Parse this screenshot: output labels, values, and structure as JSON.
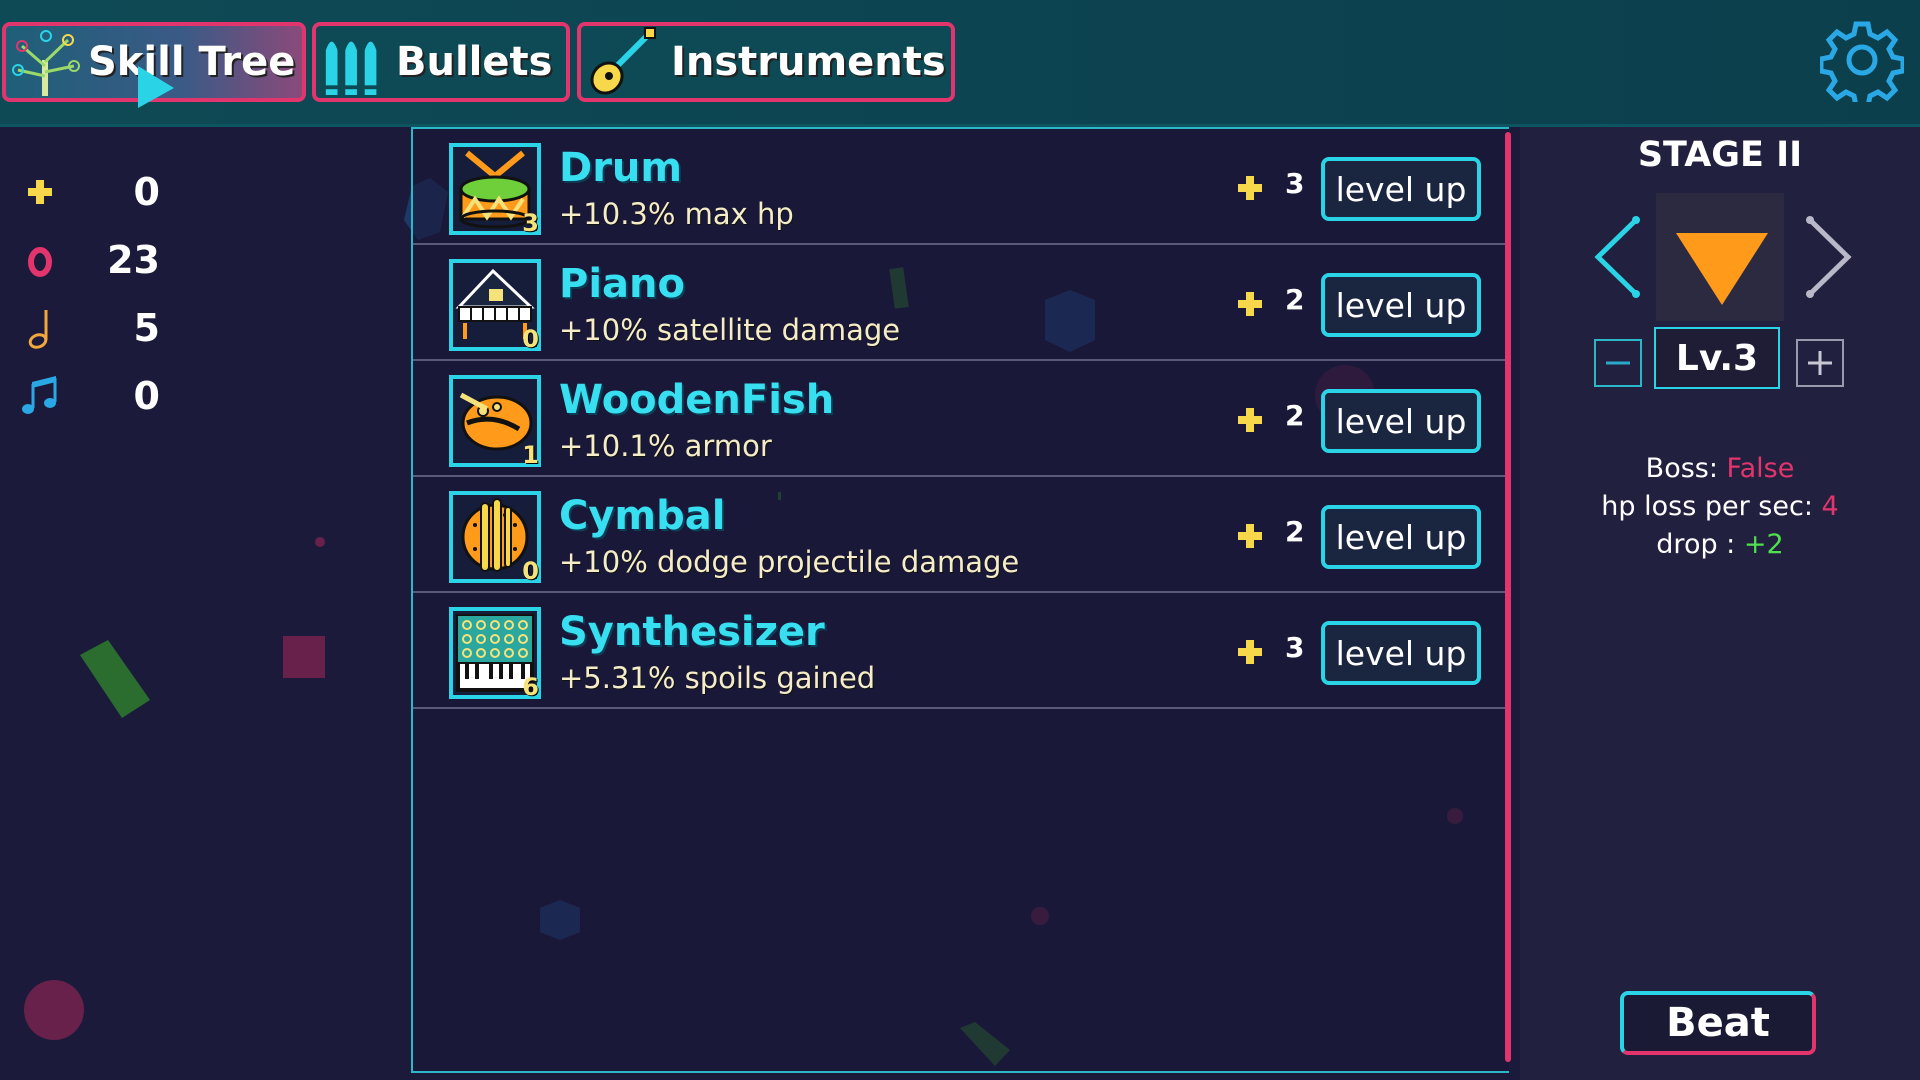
{
  "tabs": [
    {
      "label": "Skill Tree",
      "icon": "tree-icon",
      "active": true
    },
    {
      "label": "Bullets",
      "icon": "bullets-icon",
      "active": false
    },
    {
      "label": "Instruments",
      "icon": "guitar-icon",
      "active": false
    }
  ],
  "resources": [
    {
      "icon": "plus-currency-icon",
      "value": "0",
      "color": "#f6d84a"
    },
    {
      "icon": "red-ring-icon",
      "value": "23",
      "color": "#e2356d"
    },
    {
      "icon": "half-note-icon",
      "value": "5",
      "color": "#f2a83a"
    },
    {
      "icon": "beamed-notes-icon",
      "value": "0",
      "color": "#2aa8e6"
    }
  ],
  "instruments": [
    {
      "name": "Drum",
      "desc": "+10.3% max hp",
      "level": "3",
      "cost": "3",
      "button": "level up",
      "icon": "drum-icon"
    },
    {
      "name": "Piano",
      "desc": "+10% satellite damage",
      "level": "0",
      "cost": "2",
      "button": "level up",
      "icon": "piano-icon"
    },
    {
      "name": "WoodenFish",
      "desc": "+10.1% armor",
      "level": "1",
      "cost": "2",
      "button": "level up",
      "icon": "wooden-fish-icon"
    },
    {
      "name": "Cymbal",
      "desc": "+10% dodge projectile damage",
      "level": "0",
      "cost": "2",
      "button": "level up",
      "icon": "cymbal-icon"
    },
    {
      "name": "Synthesizer",
      "desc": "+5.31% spoils gained",
      "level": "6",
      "cost": "3",
      "button": "level up",
      "icon": "synthesizer-icon"
    }
  ],
  "stage": {
    "title": "STAGE II",
    "level": "Lv.3",
    "boss_label": "Boss:",
    "boss_value": "False",
    "hp_loss_label": "hp loss per sec:",
    "hp_loss_value": "4",
    "drop_label": "drop :",
    "drop_value": "+2",
    "beat_button": "Beat"
  },
  "colors": {
    "accent_cyan": "#2ad4e6",
    "accent_pink": "#e2356d",
    "gold": "#f6d84a",
    "orange": "#ff9a1a",
    "bg": "#1c1a3a"
  }
}
